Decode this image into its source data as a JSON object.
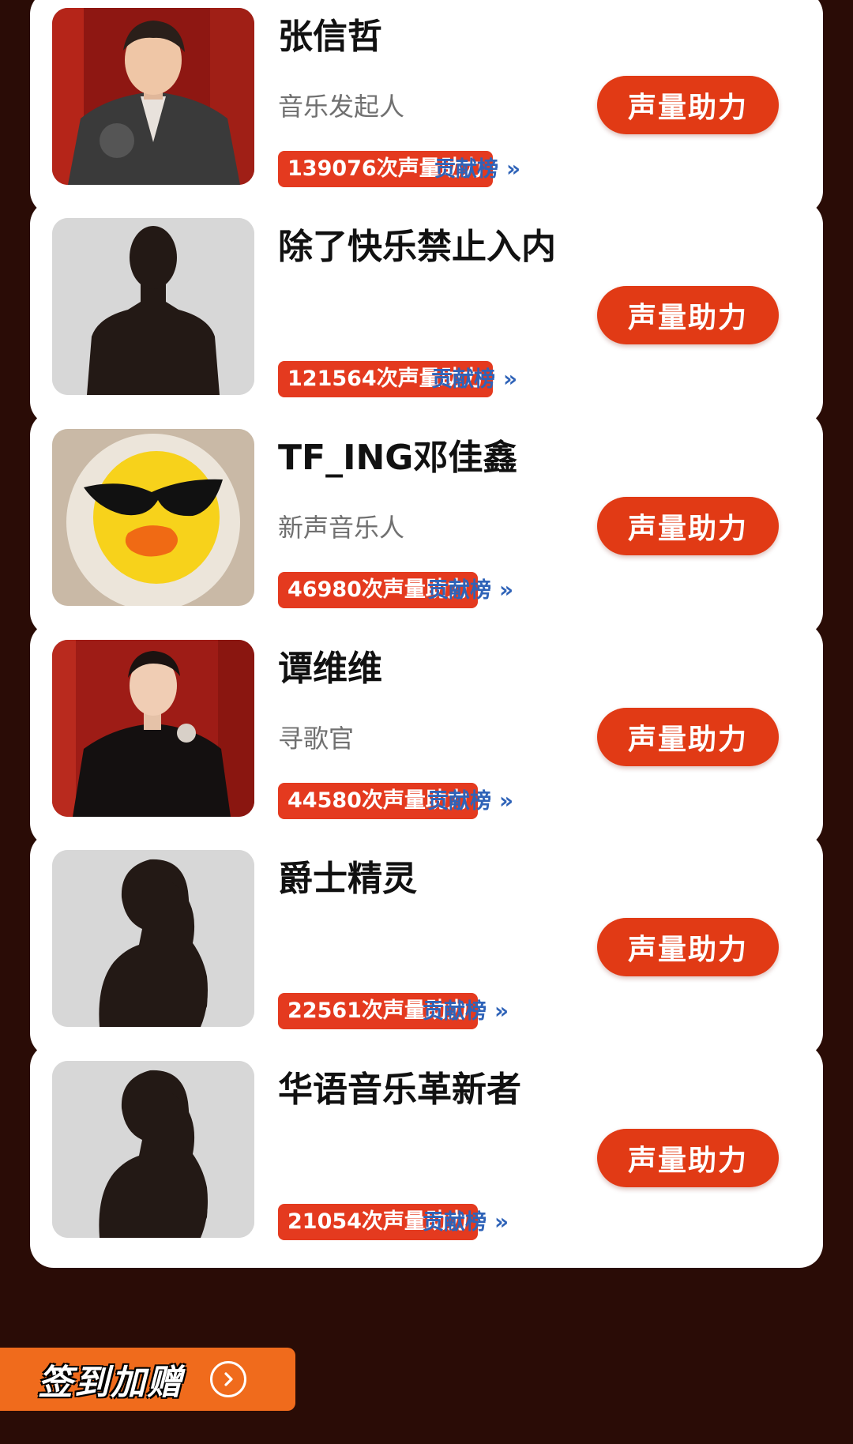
{
  "button_label": "声量助力",
  "contrib_label": "贡献榜",
  "contrib_chevron": "»",
  "cards": [
    {
      "name": "张信哲",
      "role": "音乐发起人",
      "count": "139076次声量助力",
      "avatar": "photo-man-suit"
    },
    {
      "name": "除了快乐禁止入内",
      "role": "",
      "count": "121564次声量助力",
      "avatar": "silhouette-male"
    },
    {
      "name": "TF_ING邓佳鑫",
      "role": "新声音乐人",
      "count": "46980次声量助力",
      "avatar": "duck-mask"
    },
    {
      "name": "谭维维",
      "role": "寻歌官",
      "count": "44580次声量助力",
      "avatar": "photo-woman"
    },
    {
      "name": "爵士精灵",
      "role": "",
      "count": "22561次声量助力",
      "avatar": "silhouette-female"
    },
    {
      "name": "华语音乐革新者",
      "role": "",
      "count": "21054次声量助力",
      "avatar": "silhouette-female"
    }
  ],
  "signin": {
    "label": "签到加赠",
    "icon": "chevron-right-circle-icon"
  },
  "colors": {
    "accent": "#e13a15",
    "badge": "#e43a1f",
    "link": "#2f63b8",
    "background": "#2a0c06",
    "signin": "#f06b1c"
  }
}
